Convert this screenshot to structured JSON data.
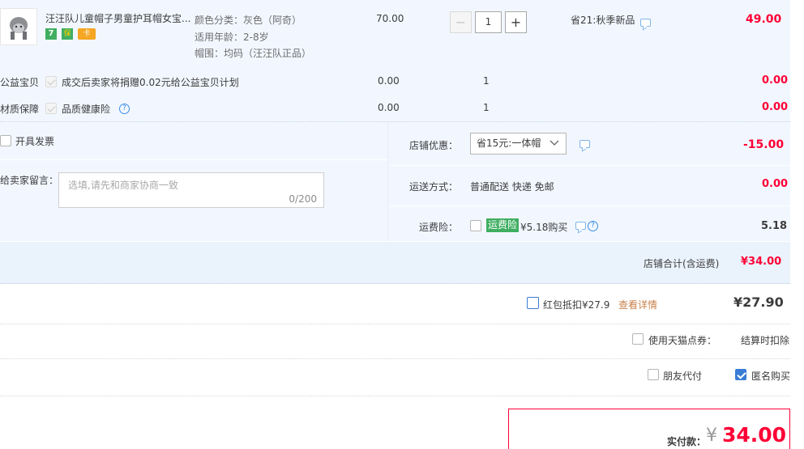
{
  "item": {
    "title": "汪汪队儿童帽子男童护耳帽女宝...",
    "specs": [
      "颜色分类：灰色（阿奇）",
      "适用年龄：2-8岁",
      "帽围：均码（汪汪队正品）"
    ],
    "badges": [
      "7",
      "保",
      "卡"
    ],
    "price": "70.00",
    "quantity": "1",
    "minus_label": "−",
    "plus_label": "+",
    "promo": "省21:秋季新品",
    "subtotal": "49.00"
  },
  "extras": [
    {
      "label": "公益宝贝",
      "desc": "成交后卖家将捐赠0.02元给公益宝贝计划",
      "price": "0.00",
      "qty": "1",
      "subtotal": "0.00"
    },
    {
      "label": "材质保障",
      "desc": "品质健康险",
      "price": "0.00",
      "qty": "1",
      "subtotal": "0.00"
    }
  ],
  "order_options": {
    "invoice_label": "开具发票",
    "message_label": "给卖家留言：",
    "message_placeholder": "选填,请先和商家协商一致",
    "message_counter": "0/200",
    "shop_discount_label": "店铺优惠：",
    "shop_discount_value": "省15元:一体帽",
    "shop_discount_amount": "-15.00",
    "shipping_label": "运送方式：",
    "shipping_value": "普通配送 快递 免邮",
    "shipping_amount": "0.00",
    "freight_insurance_label": "运费险：",
    "freight_insurance_tag": "运费险",
    "freight_insurance_price": "¥5.18购买",
    "freight_insurance_amount": "5.18",
    "shop_total_label": "店铺合计(含运费)",
    "shop_total_value": "¥34.00"
  },
  "summary": {
    "red_packet_label": "红包抵扣¥27.9",
    "red_packet_link": "查看详情",
    "red_packet_amount": "¥27.90",
    "tmall_points_label": "使用天猫点券：",
    "tmall_points_value": "结算时扣除",
    "friend_pay_label": "朋友代付",
    "anonymous_label": "匿名购买",
    "pay_label": "实付款：",
    "pay_currency": "¥",
    "pay_amount": "34.00"
  },
  "colors": {
    "accent_red": "#ff0036",
    "band_blue": "#f2f7ff",
    "link_orange": "#c8804a",
    "tag_green": "#3fae61"
  }
}
